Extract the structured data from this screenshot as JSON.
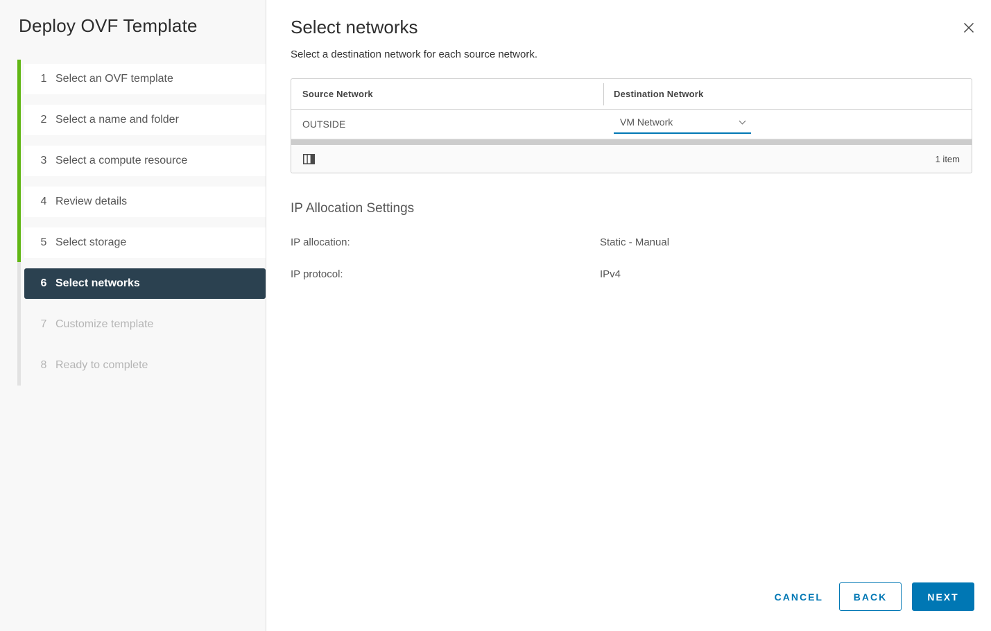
{
  "dialog": {
    "title": "Deploy OVF Template"
  },
  "sidebar": {
    "steps": [
      {
        "num": "1",
        "label": "Select an OVF template",
        "state": "done"
      },
      {
        "num": "2",
        "label": "Select a name and folder",
        "state": "done"
      },
      {
        "num": "3",
        "label": "Select a compute resource",
        "state": "done"
      },
      {
        "num": "4",
        "label": "Review details",
        "state": "done"
      },
      {
        "num": "5",
        "label": "Select storage",
        "state": "done"
      },
      {
        "num": "6",
        "label": "Select networks",
        "state": "active"
      },
      {
        "num": "7",
        "label": "Customize template",
        "state": "future"
      },
      {
        "num": "8",
        "label": "Ready to complete",
        "state": "future"
      }
    ]
  },
  "main": {
    "heading": "Select networks",
    "subheading": "Select a destination network for each source network.",
    "table": {
      "columns": [
        "Source Network",
        "Destination Network"
      ],
      "rows": [
        {
          "source": "OUTSIDE",
          "destination": "VM Network"
        }
      ],
      "footer": {
        "count": "1 item"
      }
    },
    "ip_settings": {
      "heading": "IP Allocation Settings",
      "fields": [
        {
          "label": "IP allocation:",
          "value": "Static - Manual"
        },
        {
          "label": "IP protocol:",
          "value": "IPv4"
        }
      ]
    },
    "actions": {
      "cancel": "CANCEL",
      "back": "BACK",
      "next": "NEXT"
    }
  },
  "colors": {
    "accent_blue": "#0077b4",
    "progress_green": "#61b715",
    "active_step_bg": "#2b4150"
  }
}
